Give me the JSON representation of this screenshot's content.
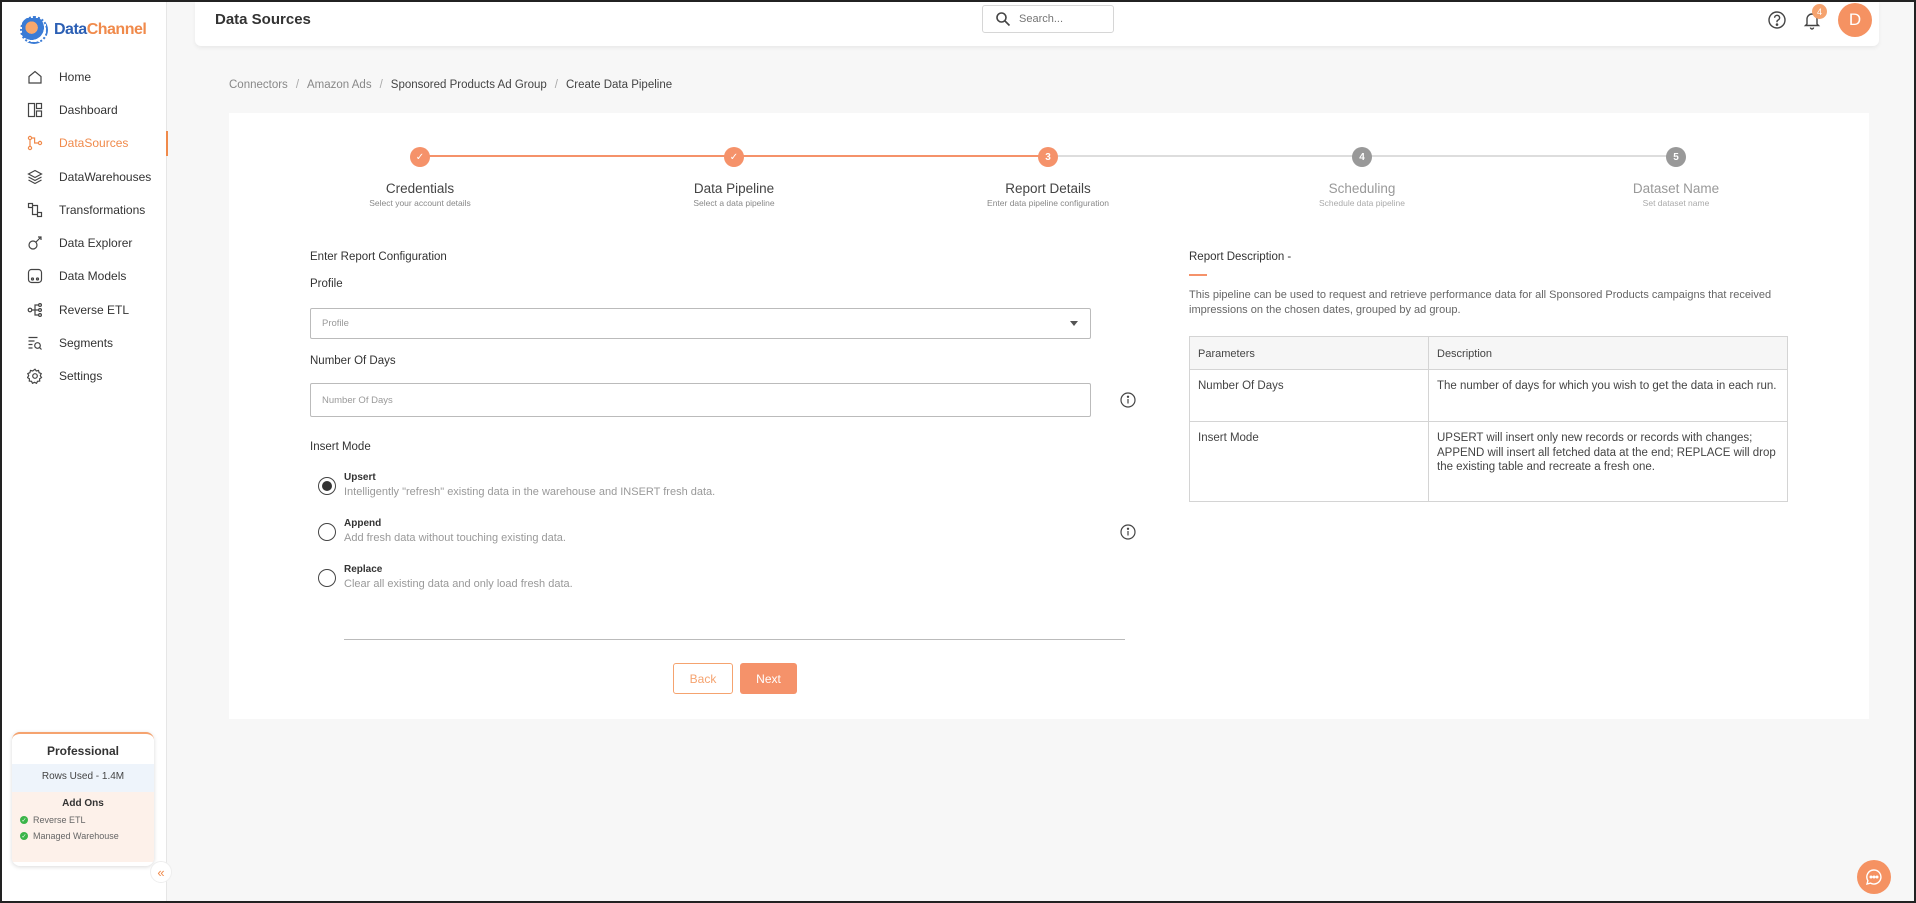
{
  "brand": {
    "name_part1": "Data",
    "name_part2": "Channel"
  },
  "sidebar": {
    "items": [
      {
        "label": "Home",
        "icon": "home-icon"
      },
      {
        "label": "Dashboard",
        "icon": "dashboard-icon"
      },
      {
        "label": "DataSources",
        "icon": "datasources-icon",
        "active": true
      },
      {
        "label": "DataWarehouses",
        "icon": "layers-icon"
      },
      {
        "label": "Transformations",
        "icon": "transform-icon"
      },
      {
        "label": "Data Explorer",
        "icon": "explorer-icon"
      },
      {
        "label": "Data Models",
        "icon": "models-icon"
      },
      {
        "label": "Reverse ETL",
        "icon": "reverse-etl-icon"
      },
      {
        "label": "Segments",
        "icon": "segments-icon"
      },
      {
        "label": "Settings",
        "icon": "gear-icon"
      }
    ],
    "plan": {
      "title": "Professional",
      "rows_used": "Rows Used - 1.4M",
      "addons_title": "Add Ons",
      "addons": [
        "Reverse ETL",
        "Managed Warehouse"
      ]
    }
  },
  "header": {
    "title": "Data Sources",
    "search_placeholder": "Search...",
    "notification_count": "4",
    "avatar_initial": "D"
  },
  "breadcrumb": [
    "Connectors",
    "Amazon Ads",
    "Sponsored Products Ad Group",
    "Create Data Pipeline"
  ],
  "stepper": {
    "steps": [
      {
        "number": "1",
        "title": "Credentials",
        "subtitle": "Select your account details",
        "state": "done"
      },
      {
        "number": "2",
        "title": "Data Pipeline",
        "subtitle": "Select a data pipeline",
        "state": "done"
      },
      {
        "number": "3",
        "title": "Report Details",
        "subtitle": "Enter data pipeline configuration",
        "state": "current"
      },
      {
        "number": "4",
        "title": "Scheduling",
        "subtitle": "Schedule data pipeline",
        "state": "pending"
      },
      {
        "number": "5",
        "title": "Dataset Name",
        "subtitle": "Set dataset name",
        "state": "pending"
      }
    ]
  },
  "form": {
    "heading": "Enter Report Configuration",
    "profile_label": "Profile",
    "profile_placeholder": "Profile",
    "days_label": "Number Of Days",
    "days_placeholder": "Number Of Days",
    "insert_mode_label": "Insert Mode",
    "insert_modes": [
      {
        "title": "Upsert",
        "desc": "Intelligently \"refresh\" existing data in the warehouse and INSERT fresh data.",
        "selected": true
      },
      {
        "title": "Append",
        "desc": "Add fresh data without touching existing data.",
        "selected": false
      },
      {
        "title": "Replace",
        "desc": "Clear all existing data and only load fresh data.",
        "selected": false
      }
    ],
    "back_label": "Back",
    "next_label": "Next"
  },
  "report": {
    "title": "Report Description -",
    "description": "This pipeline can be used to request and retrieve performance data for all Sponsored Products campaigns that received impressions on the chosen dates, grouped by ad group.",
    "table": {
      "headers": [
        "Parameters",
        "Description"
      ],
      "rows": [
        [
          "Number Of Days",
          "The number of days for which you wish to get the data in each run."
        ],
        [
          "Insert Mode",
          "UPSERT will insert only new records or records with changes; APPEND will insert all fetched data at the end; REPLACE will drop the existing table and recreate a fresh one."
        ]
      ]
    }
  },
  "colors": {
    "accent": "#f5926a",
    "brand_blue": "#2b5fb4",
    "inactive": "#999999"
  }
}
